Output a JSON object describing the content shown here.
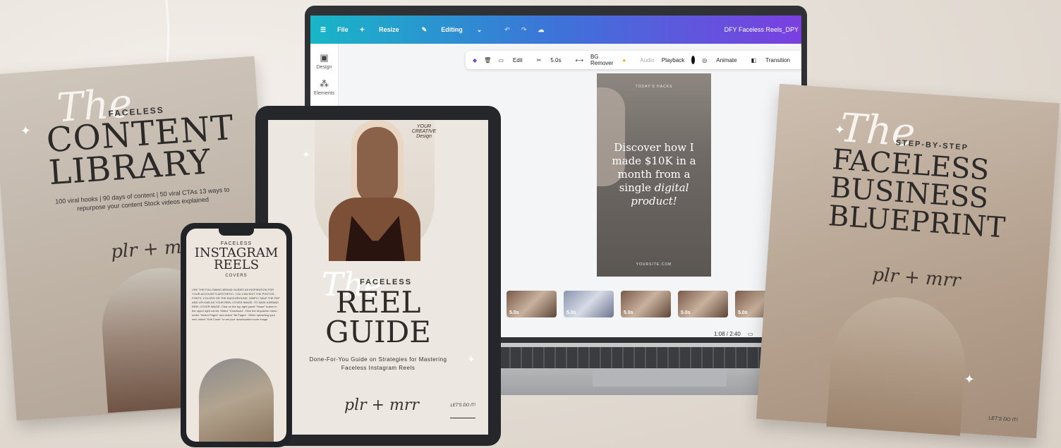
{
  "canva": {
    "menu": {
      "menu_icon": "menu-icon",
      "file": "File",
      "resize": "Resize",
      "editing": "Editing"
    },
    "doc_title": "DFY Faceless Reels_DPY",
    "side": [
      {
        "label": "Design"
      },
      {
        "label": "Elements"
      }
    ],
    "toolbar": {
      "edit": "Edit",
      "duration": "5.0s",
      "bg_remover": "BG Remover",
      "audio": "Audio",
      "playback": "Playback",
      "animate": "Animate",
      "transition": "Transition"
    },
    "reel": {
      "top": "TODAY'S HACKS",
      "headline_a": "Discover how I made $10K in a month from a single ",
      "headline_b": "digital product",
      "headline_c": "!",
      "bottom": "YOURSITE.COM"
    },
    "clips": [
      "5.0s",
      "5.0s",
      "5.0s",
      "5.0s",
      "5.0s"
    ],
    "time": "1:08 / 2:40"
  },
  "left_book": {
    "the": "The",
    "faceless": "FACELESS",
    "title": "CONTENT LIBRARY",
    "sub": "100 viral hooks | 90 days of content | 50 viral CTAs 13 ways to repurpose your content Stock videos explained",
    "sign": "plr + mrr"
  },
  "tablet": {
    "logo": "YOUR CREATIVE Design",
    "the": "The",
    "faceless": "FACELESS",
    "title": "REEL GUIDE",
    "desc": "Done-For-You Guide on Strategies for Mastering Faceless Instagram Reels",
    "sign": "plr + mrr",
    "lets": "LET'S DO IT!"
  },
  "phone": {
    "faceless": "FACELESS",
    "title": "INSTAGRAM REELS",
    "covers": "COVERS",
    "text": "USE THE FOLLOWING BRAND GUIDES AS INSPIRATION FOR YOUR ACCOUNT'S AESTHETIC. YOU CAN EDIT THE PHOTOS, FONTS, COLORS OR THE BACKGROUND. SIMPLY SAVE THE PDF AND UPLOAD AS YOUR REEL COVER IMAGE. TO SAVE A BRAND REEL COVER IMAGE: Click on the top-right panel \"Share\" button in the upper right corner. Select \"Download\". Click the dropdown menu under \"Select Pages\" and select \"All Pages\". When uploading your reel, select \"Edit Cover\" to set your downloaded cover image."
  },
  "right_book": {
    "the": "The",
    "step": "STEP-BY-STEP",
    "title": "FACELESS BUSINESS BLUEPRINT",
    "sign": "plr + mrr",
    "lets": "LET'S DO IT!"
  }
}
